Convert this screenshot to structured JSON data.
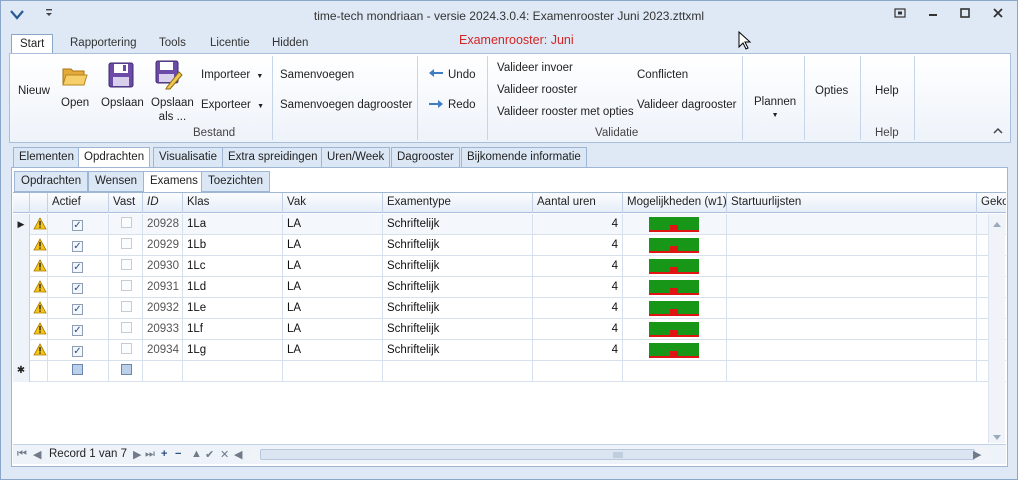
{
  "window": {
    "title": "time-tech mondriaan - versie 2024.3.0.4: Examenrooster Juni 2023.zttxml",
    "controls": [
      "restore-down",
      "minimize",
      "maximize",
      "close"
    ]
  },
  "ribbon": {
    "tabs": [
      {
        "label": "Start",
        "active": true
      },
      {
        "label": "Rapportering"
      },
      {
        "label": "Tools"
      },
      {
        "label": "Licentie"
      },
      {
        "label": "Hidden"
      }
    ],
    "context_title": "Examenrooster: Juni",
    "context_title_color": "#d22424",
    "buttons": {
      "nieuw": "Nieuw",
      "open": "Open",
      "opslaan": "Opslaan",
      "opslaan_als_1": "Opslaan",
      "opslaan_als_2": "als ...",
      "importeer": "Importeer",
      "exporteer": "Exporteer",
      "samenvoegen": "Samenvoegen",
      "samenvoegen_dagrooster": "Samenvoegen dagrooster",
      "undo": "Undo",
      "redo": "Redo",
      "valideer_invoer": "Valideer invoer",
      "valideer_rooster": "Valideer rooster",
      "valideer_rooster_met_opties": "Valideer rooster met opties",
      "conflicten": "Conflicten",
      "valideer_dagrooster": "Valideer dagrooster",
      "plannen": "Plannen",
      "opties": "Opties",
      "help": "Help"
    },
    "groups": {
      "bestand": "Bestand",
      "validatie": "Validatie",
      "help": "Help"
    }
  },
  "main_tabs": [
    {
      "label": "Elementen"
    },
    {
      "label": "Opdrachten",
      "active": true
    },
    {
      "label": "Visualisatie"
    },
    {
      "label": "Extra spreidingen"
    },
    {
      "label": "Uren/Week"
    },
    {
      "label": "Dagrooster"
    },
    {
      "label": "Bijkomende informatie"
    }
  ],
  "sub_tabs": [
    {
      "label": "Opdrachten"
    },
    {
      "label": "Wensen"
    },
    {
      "label": "Examens",
      "active": true
    },
    {
      "label": "Toezichten"
    }
  ],
  "grid": {
    "columns": [
      "Actief",
      "Vast",
      "ID",
      "Klas",
      "Vak",
      "Examentype",
      "Aantal uren",
      "Mogelijkheden (w1)",
      "Startuurlijsten",
      "Geko"
    ],
    "rows": [
      {
        "id": "20928",
        "klas": "1La",
        "vak": "LA",
        "examentype": "Schriftelijk",
        "uren": "4",
        "actief": true,
        "vast": false
      },
      {
        "id": "20929",
        "klas": "1Lb",
        "vak": "LA",
        "examentype": "Schriftelijk",
        "uren": "4",
        "actief": true,
        "vast": false
      },
      {
        "id": "20930",
        "klas": "1Lc",
        "vak": "LA",
        "examentype": "Schriftelijk",
        "uren": "4",
        "actief": true,
        "vast": false
      },
      {
        "id": "20931",
        "klas": "1Ld",
        "vak": "LA",
        "examentype": "Schriftelijk",
        "uren": "4",
        "actief": true,
        "vast": false
      },
      {
        "id": "20932",
        "klas": "1Le",
        "vak": "LA",
        "examentype": "Schriftelijk",
        "uren": "4",
        "actief": true,
        "vast": false
      },
      {
        "id": "20933",
        "klas": "1Lf",
        "vak": "LA",
        "examentype": "Schriftelijk",
        "uren": "4",
        "actief": true,
        "vast": false
      },
      {
        "id": "20934",
        "klas": "1Lg",
        "vak": "LA",
        "examentype": "Schriftelijk",
        "uren": "4",
        "actief": true,
        "vast": false
      }
    ],
    "new_row_marker": "✱"
  },
  "navigator": {
    "record_text": "Record 1 van 7"
  }
}
